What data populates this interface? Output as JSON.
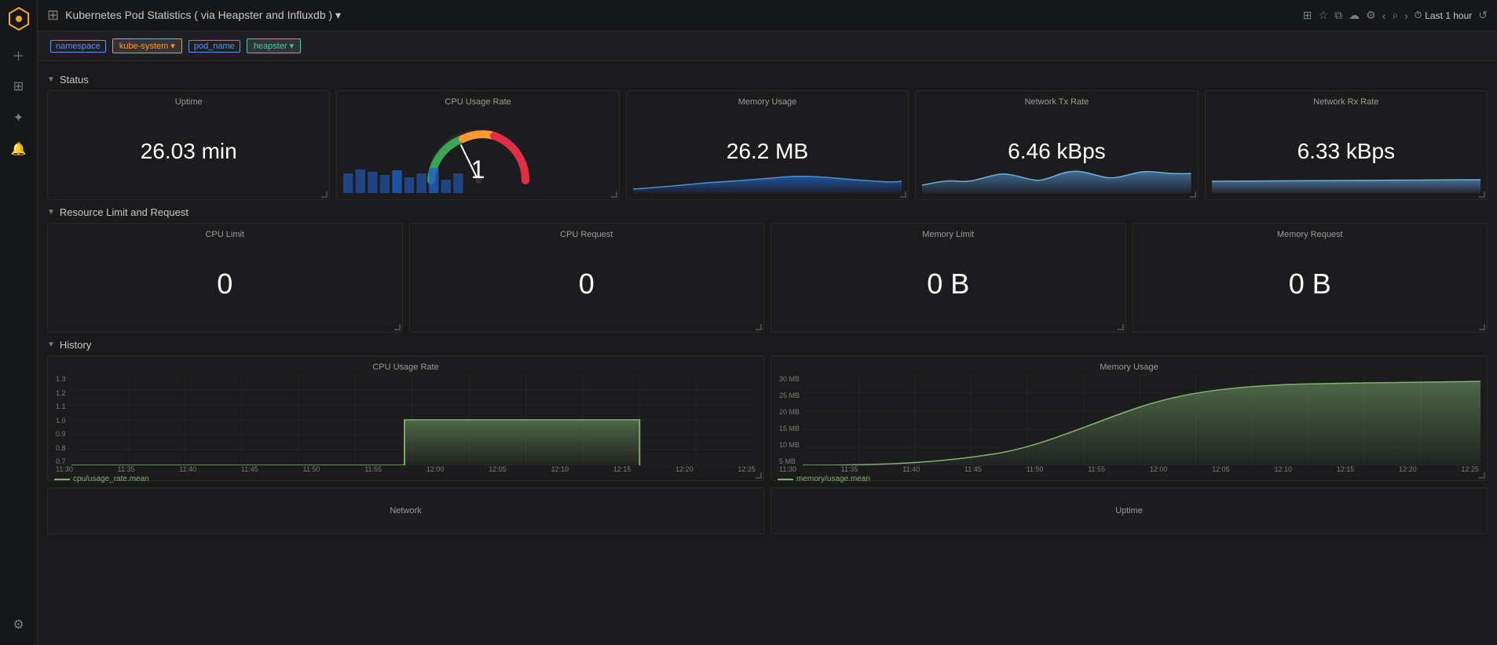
{
  "app": {
    "logo_icon": "⬡",
    "title": "Kubernetes Pod Statistics ( via Heapster and Influxdb ) ▾"
  },
  "topbar": {
    "title": "Kubernetes Pod Statistics ( via Heapster and Influxdb ) ▾",
    "actions": {
      "dashboard_icon": "▦",
      "star_icon": "☆",
      "share_icon": "⧉",
      "save_icon": "☁",
      "settings_icon": "⚙",
      "prev_icon": "‹",
      "search_icon": "⌕",
      "next_icon": "›",
      "time_label": "Last 1 hour",
      "refresh_icon": "↺"
    }
  },
  "filters": [
    {
      "label": "namespace",
      "value": "kube-system ▾",
      "type": "orange"
    },
    {
      "label": "pod_name",
      "value": "heapster ▾",
      "type": "teal"
    }
  ],
  "sections": {
    "status": {
      "label": "Status",
      "cards": [
        {
          "title": "Uptime",
          "value": "26.03 min",
          "type": "text"
        },
        {
          "title": "CPU Usage Rate",
          "value": "1",
          "type": "gauge"
        },
        {
          "title": "Memory Usage",
          "value": "26.2 MB",
          "type": "text_spark"
        },
        {
          "title": "Network Tx Rate",
          "value": "6.46 kBps",
          "type": "text_spark"
        },
        {
          "title": "Network Rx Rate",
          "value": "6.33 kBps",
          "type": "text_spark"
        }
      ]
    },
    "resource": {
      "label": "Resource Limit and Request",
      "cards": [
        {
          "title": "CPU Limit",
          "value": "0",
          "type": "text"
        },
        {
          "title": "CPU Request",
          "value": "0",
          "type": "text"
        },
        {
          "title": "Memory Limit",
          "value": "0 B",
          "type": "text"
        },
        {
          "title": "Memory Request",
          "value": "0 B",
          "type": "text"
        }
      ]
    },
    "history": {
      "label": "History",
      "charts": [
        {
          "title": "CPU Usage Rate",
          "legend": "cpu/usage_rate.mean",
          "y_labels": [
            "1.3",
            "1.2",
            "1.1",
            "1.0",
            "0.9",
            "0.8",
            "0.7"
          ],
          "x_labels": [
            "11:30",
            "11:35",
            "11:40",
            "11:45",
            "11:50",
            "11:55",
            "12:00",
            "12:05",
            "12:10",
            "12:15",
            "12:20",
            "12:25"
          ]
        },
        {
          "title": "Memory Usage",
          "legend": "memory/usage.mean",
          "y_labels": [
            "30 MB",
            "25 MB",
            "20 MB",
            "15 MB",
            "10 MB",
            "5 MB"
          ],
          "x_labels": [
            "11:30",
            "11:35",
            "11:40",
            "11:45",
            "11:50",
            "11:55",
            "12:00",
            "12:05",
            "12:10",
            "12:15",
            "12:20",
            "12:25"
          ]
        }
      ]
    },
    "bottom": {
      "charts": [
        {
          "title": "Network"
        },
        {
          "title": "Uptime"
        }
      ]
    }
  },
  "colors": {
    "accent_orange": "#ff9830",
    "accent_teal": "#48c7a5",
    "accent_blue": "#5794f2",
    "green_chart": "#7eb26d",
    "gauge_green": "#3aa655",
    "gauge_orange": "#ff9830",
    "gauge_red": "#e02f44",
    "bg_card": "#1c1c1e",
    "bg_dark": "#161719",
    "border": "#2a2a2a",
    "text_dim": "#7b7b7b",
    "text_main": "#c7c7c7",
    "spark_blue": "#1f60c4"
  }
}
